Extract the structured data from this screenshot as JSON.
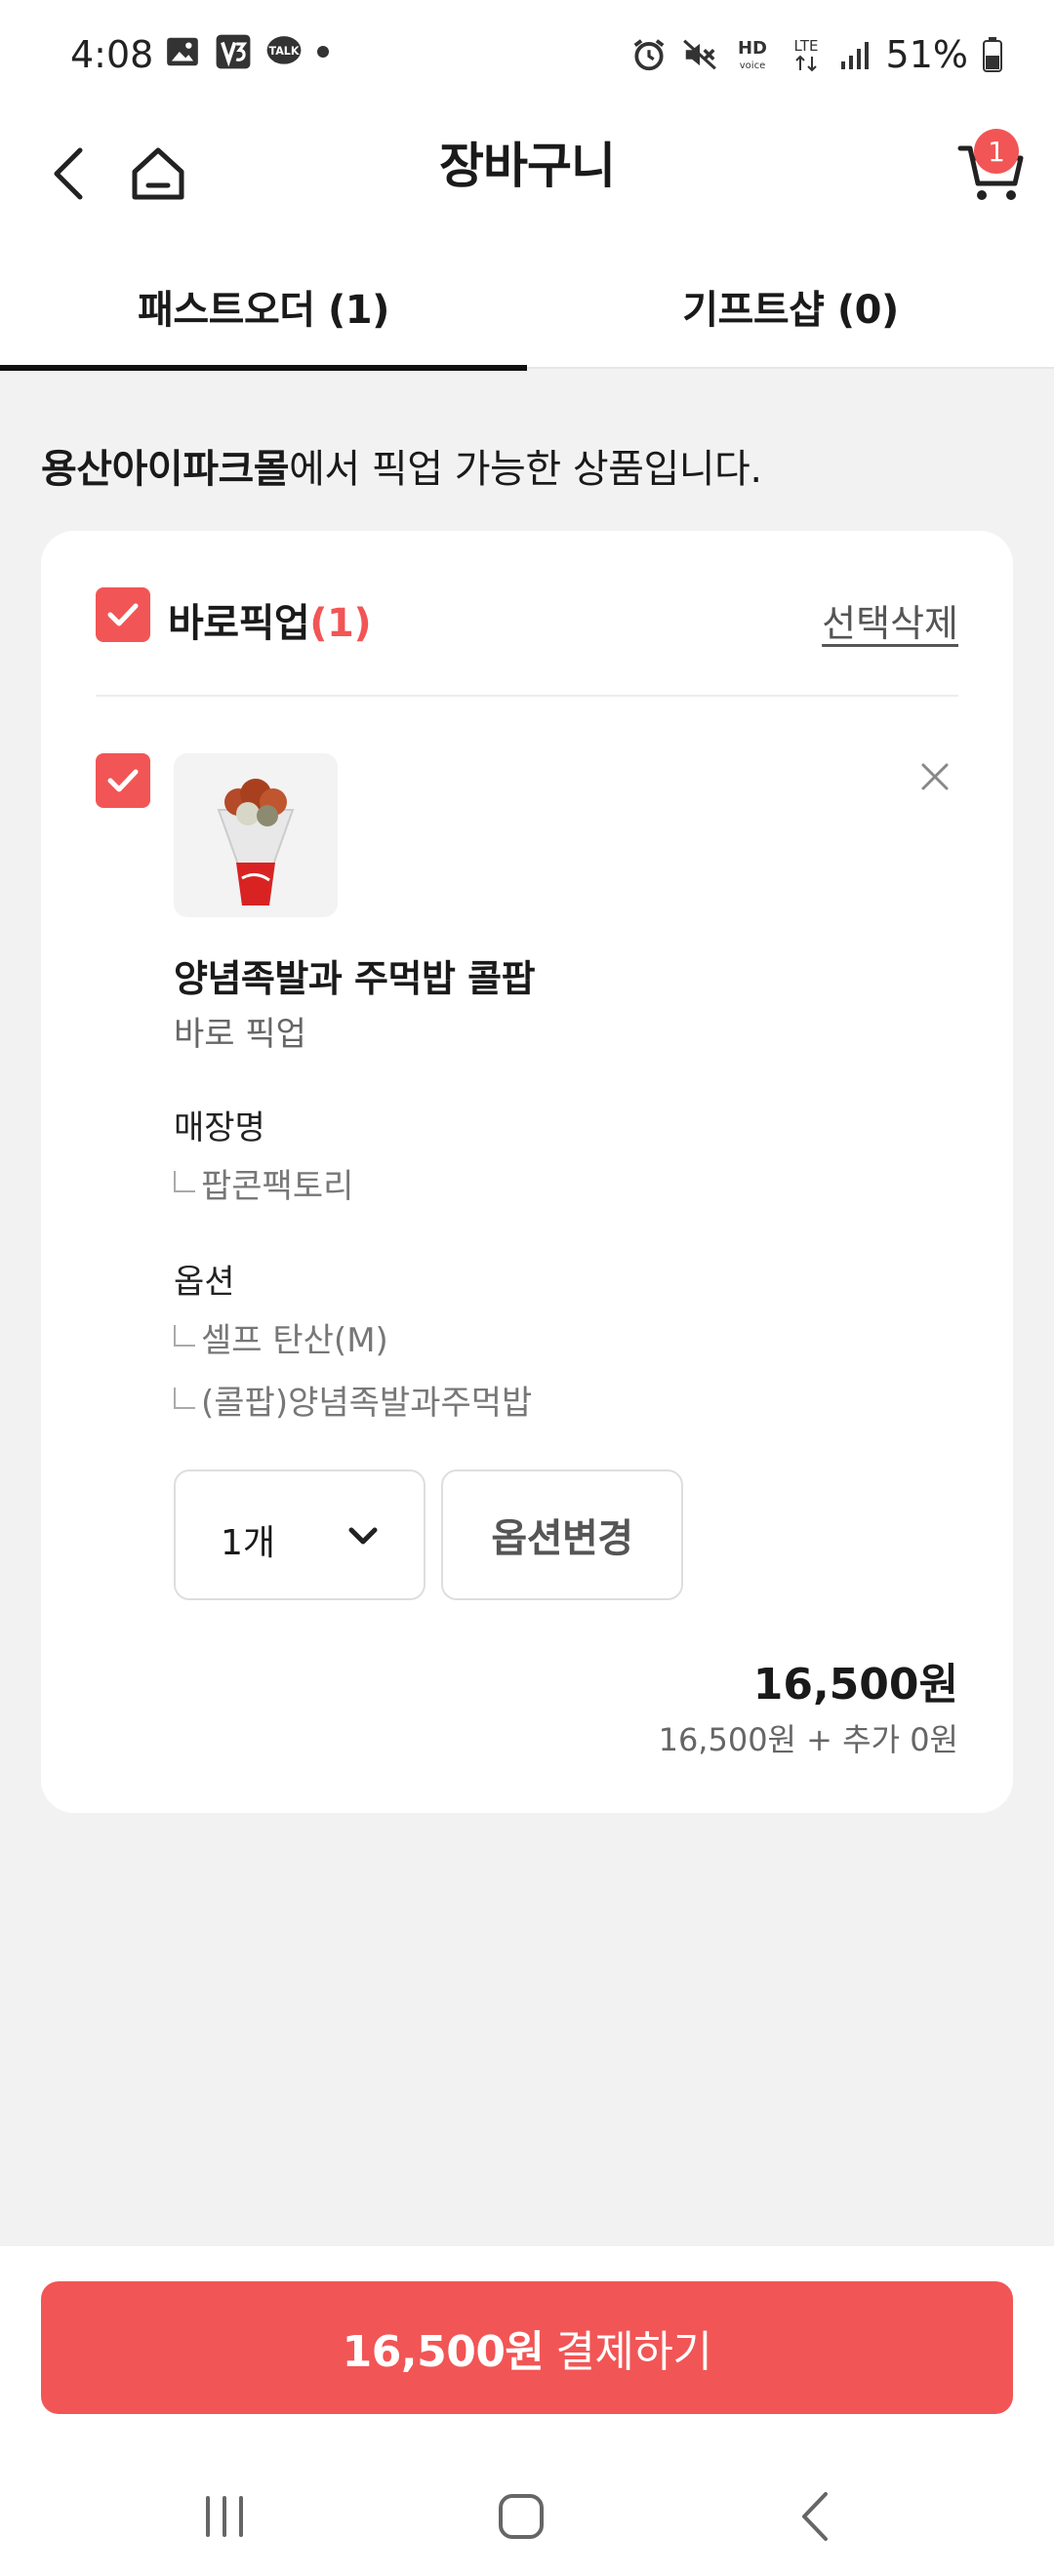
{
  "status_bar": {
    "time": "4:08",
    "battery": "51%",
    "icons": [
      "gallery-icon",
      "v3-app-icon",
      "kakaotalk-icon",
      "dot-icon",
      "alarm-icon",
      "mute-icon",
      "hd-voice-icon",
      "lte-icon",
      "signal-icon",
      "battery-icon"
    ]
  },
  "header": {
    "title": "장바구니",
    "cart_count": "1"
  },
  "tabs": [
    {
      "label": "패스트오더 (1)",
      "active": true
    },
    {
      "label": "기프트샵 (0)",
      "active": false
    }
  ],
  "notice": {
    "store": "용산아이파크몰",
    "text": "에서 픽업 가능한 상품입니다."
  },
  "section": {
    "title": "바로픽업",
    "count": "(1)",
    "delete_label": "선택삭제"
  },
  "item": {
    "name": "양념족발과 주먹밥 콜팝",
    "type": "바로 픽업",
    "store_label": "매장명",
    "store_name": "팝콘팩토리",
    "option_label": "옵션",
    "options": [
      "셀프 탄산(M)",
      "(콜팝)양념족발과주먹밥"
    ],
    "quantity": "1개",
    "change_option": "옵션변경",
    "price": "16,500원",
    "price_detail": "16,500원 + 추가 0원"
  },
  "checkout": {
    "amount": "16,500원",
    "label": "결제하기"
  },
  "colors": {
    "accent": "#f25555",
    "background": "#f2f2f3"
  }
}
